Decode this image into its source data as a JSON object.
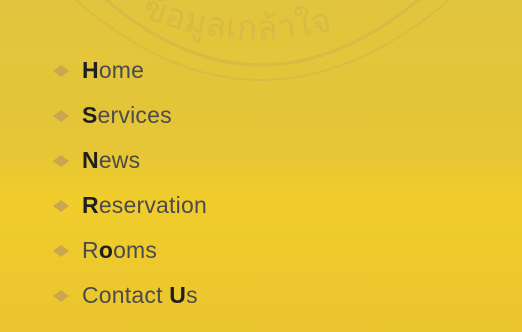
{
  "colors": {
    "background_top": "#e2c53e",
    "background_bottom": "#eac52f",
    "text": "#4b4b4b",
    "initial_text": "#1f1f1f",
    "bullet": "#c9a64f"
  },
  "watermark": {
    "text": "ข้อมูลเกล้าใจ"
  },
  "menu": {
    "items": [
      {
        "icon": "diamond-bullet-icon",
        "parts": [
          "H",
          "ome"
        ]
      },
      {
        "icon": "diamond-bullet-icon",
        "parts": [
          "S",
          "ervices"
        ]
      },
      {
        "icon": "diamond-bullet-icon",
        "parts": [
          "N",
          "ews"
        ]
      },
      {
        "icon": "diamond-bullet-icon",
        "parts": [
          "R",
          "eservation"
        ]
      },
      {
        "icon": "diamond-bullet-icon",
        "parts": [
          "R",
          "o",
          "oms"
        ]
      },
      {
        "icon": "diamond-bullet-icon",
        "parts": [
          "Contact ",
          "U",
          "s"
        ]
      }
    ]
  }
}
